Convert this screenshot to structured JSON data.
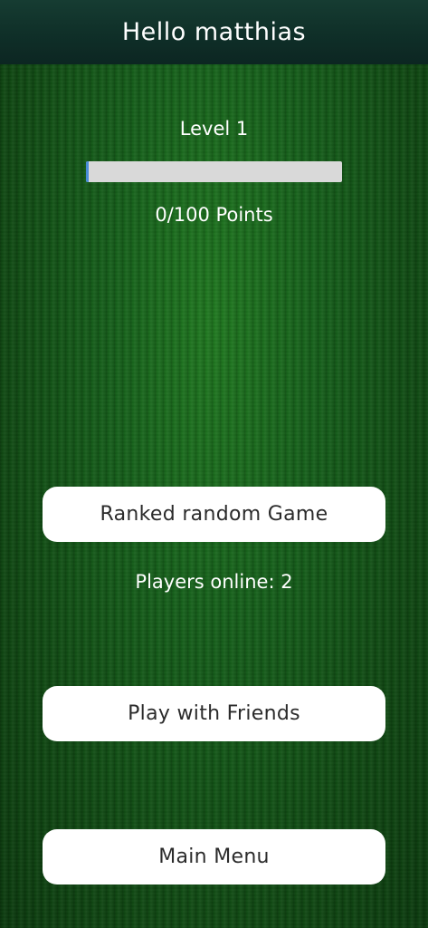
{
  "header": {
    "greeting": "Hello matthias"
  },
  "progress": {
    "level_label": "Level 1",
    "points_label": "0/100 Points",
    "fill_fraction": 0.01,
    "track_color": "#d9d9d9",
    "fill_color": "#4a8cd8"
  },
  "actions": {
    "ranked_label": "Ranked random Game",
    "players_online_label": "Players online: 2",
    "friends_label": "Play with Friends",
    "main_menu_label": "Main Menu"
  },
  "colors": {
    "background": "#15611a",
    "header": "#0f2f28",
    "button_bg": "#ffffff",
    "button_text": "#2b2b2b"
  }
}
